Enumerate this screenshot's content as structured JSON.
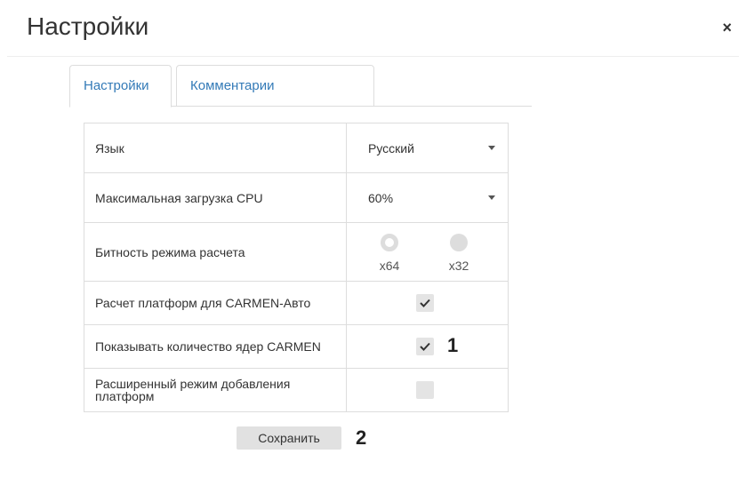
{
  "modal": {
    "title": "Настройки",
    "close_glyph": "×"
  },
  "tabs": [
    {
      "label": "Настройки",
      "active": true
    },
    {
      "label": "Комментарии",
      "active": false
    }
  ],
  "settings": {
    "language": {
      "label": "Язык",
      "value": "Русский"
    },
    "cpu": {
      "label": "Максимальная загрузка CPU",
      "value": "60%"
    },
    "bitness": {
      "label": "Битность режима расчета",
      "options": [
        {
          "label": "x64",
          "selected": true
        },
        {
          "label": "x32",
          "selected": false
        }
      ]
    },
    "carmen_auto": {
      "label": "Расчет платформ для CARMEN-Авто",
      "checked": true
    },
    "show_cores": {
      "label": "Показывать количество ядер CARMEN",
      "checked": true
    },
    "extended_mode": {
      "label": "Расширенный режим добавления платформ",
      "checked": false
    }
  },
  "save_label": "Сохранить",
  "callouts": [
    "1",
    "2"
  ],
  "icons": {
    "close": "close-icon",
    "caret": "chevron-down-icon",
    "check": "checkmark-icon"
  },
  "colors": {
    "tab_link": "#337ab7",
    "border": "#dddddd",
    "control_bg": "#e1e1e1"
  }
}
